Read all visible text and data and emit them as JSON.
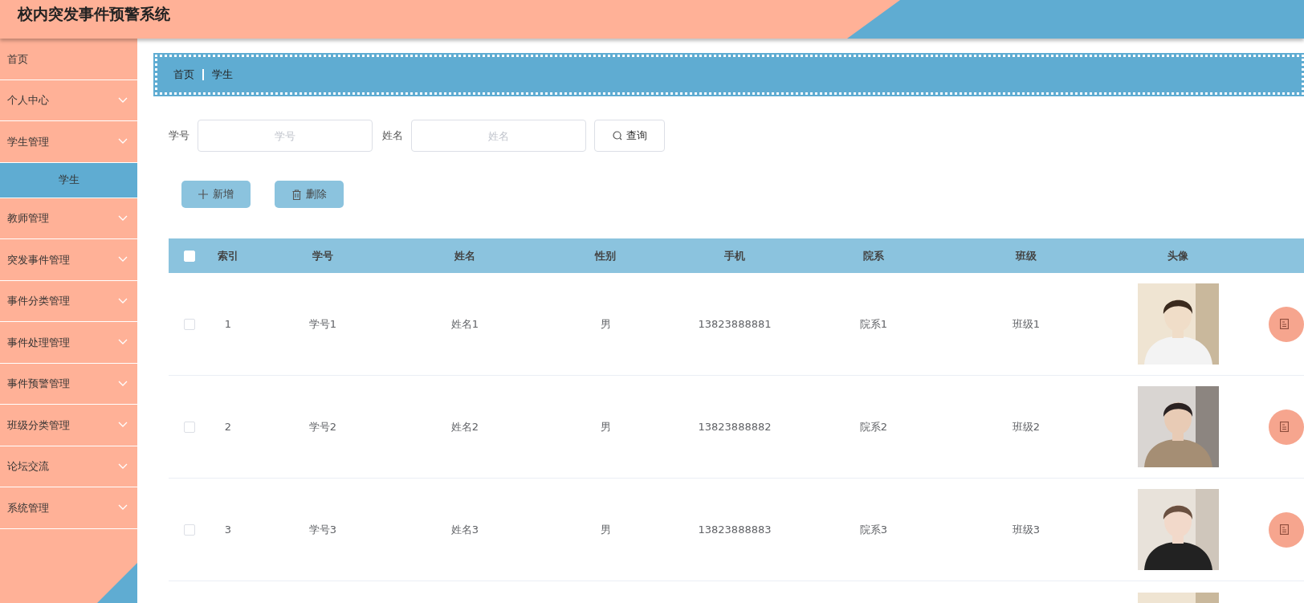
{
  "header": {
    "title": "校内突发事件预警系统"
  },
  "sidebar": {
    "items": [
      {
        "label": "首页",
        "submenu": false,
        "selected": false
      },
      {
        "label": "个人中心",
        "submenu": true,
        "selected": false
      },
      {
        "label": "学生管理",
        "submenu": true,
        "selected": false,
        "children": [
          {
            "label": "学生",
            "selected": true
          }
        ]
      },
      {
        "label": "教师管理",
        "submenu": true,
        "selected": false
      },
      {
        "label": "突发事件管理",
        "submenu": true,
        "selected": false
      },
      {
        "label": "事件分类管理",
        "submenu": true,
        "selected": false
      },
      {
        "label": "事件处理管理",
        "submenu": true,
        "selected": false
      },
      {
        "label": "事件预警管理",
        "submenu": true,
        "selected": false
      },
      {
        "label": "班级分类管理",
        "submenu": true,
        "selected": false
      },
      {
        "label": "论坛交流",
        "submenu": true,
        "selected": false
      },
      {
        "label": "系统管理",
        "submenu": true,
        "selected": false
      }
    ]
  },
  "breadcrumb": [
    "首页",
    "学生"
  ],
  "search": {
    "fields": [
      {
        "label": "学号",
        "placeholder": "学号"
      },
      {
        "label": "姓名",
        "placeholder": "姓名"
      }
    ],
    "button": "查询"
  },
  "actions": [
    {
      "kind": "add",
      "label": "新增"
    },
    {
      "kind": "delete",
      "label": "删除"
    }
  ],
  "table": {
    "select_all": {
      "checked": false
    },
    "columns": [
      "索引",
      "学号",
      "姓名",
      "性别",
      "手机",
      "院系",
      "班级",
      "头像"
    ],
    "rows": [
      {
        "checked": false,
        "cells": [
          "1",
          "学号1",
          "姓名1",
          "男",
          "13823888881",
          "院系1",
          "班级1"
        ],
        "avatar": {
          "kind": "picture"
        }
      },
      {
        "checked": false,
        "cells": [
          "2",
          "学号2",
          "姓名2",
          "男",
          "13823888882",
          "院系2",
          "班级2"
        ],
        "avatar": {
          "kind": "picture"
        }
      },
      {
        "checked": false,
        "cells": [
          "3",
          "学号3",
          "姓名3",
          "男",
          "13823888883",
          "院系3",
          "班级3"
        ],
        "avatar": {
          "kind": "picture"
        }
      }
    ],
    "partial_row": {
      "avatar": {
        "kind": "picture"
      }
    }
  }
}
